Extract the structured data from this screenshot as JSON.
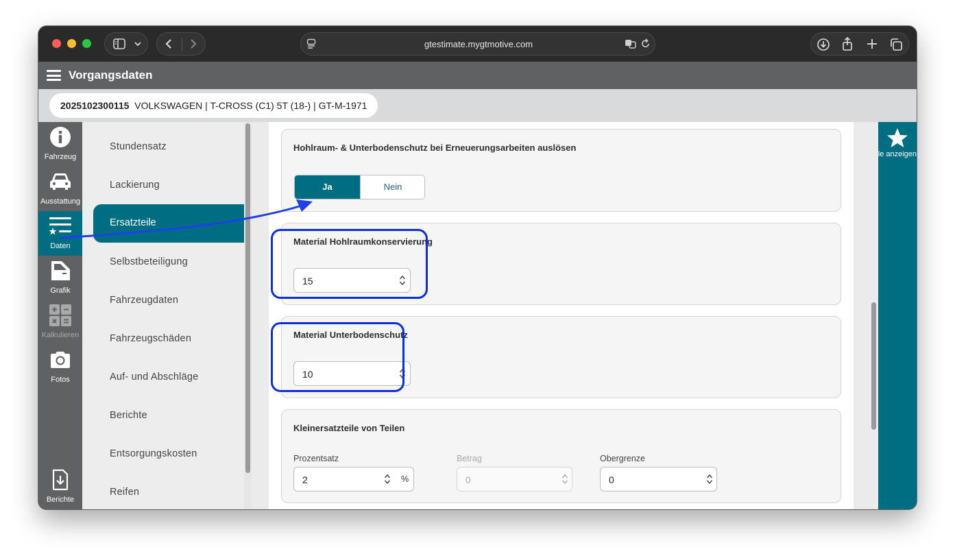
{
  "browser": {
    "url": "gtestimate.mygtmotive.com",
    "icons": [
      "sidebar-icon",
      "chevron-down-icon",
      "back-icon",
      "forward-icon",
      "page-icon",
      "translate-icon",
      "reload-icon",
      "download-icon",
      "share-icon",
      "new-tab-icon",
      "tabs-icon"
    ]
  },
  "app": {
    "title": "Vorgangsdaten",
    "vehicle": {
      "id": "2025102300115",
      "description": "VOLKSWAGEN | T-CROSS (C1) 5T (18-) | GT-M-1971"
    }
  },
  "rail": {
    "items": [
      {
        "label": "Fahrzeug",
        "icon": "info-icon"
      },
      {
        "label": "Ausstattung",
        "icon": "car-icon"
      },
      {
        "label": "Daten",
        "icon": "list-star-icon",
        "active": true
      },
      {
        "label": "Grafik",
        "icon": "door-icon"
      },
      {
        "label": "Kalkulieren",
        "icon": "calculator-icon",
        "disabled": true
      },
      {
        "label": "Fotos",
        "icon": "camera-icon"
      },
      {
        "label": "Berichte",
        "icon": "file-download-icon"
      }
    ]
  },
  "subnav": {
    "items": [
      "Stundensatz",
      "Lackierung",
      "Ersatzteile",
      "Selbstbeteiligung",
      "Fahrzeugdaten",
      "Fahrzeugschäden",
      "Auf- und Abschläge",
      "Berichte",
      "Entsorgungskosten",
      "Reifen"
    ],
    "active": "Ersatzteile"
  },
  "main": {
    "cavity_trigger": {
      "title": "Hohlraum- & Unterbodenschutz bei Erneuerungsarbeiten auslösen",
      "options": [
        "Ja",
        "Nein"
      ],
      "selected": "Ja"
    },
    "cavity_material": {
      "title": "Material Hohlraumkonservierung",
      "value": "15"
    },
    "underbody_material": {
      "title": "Material Unterbodenschutz",
      "value": "10"
    },
    "small_parts": {
      "title": "Kleinersatzteile von Teilen",
      "percent_label": "Prozentsatz",
      "percent_value": "2",
      "percent_unit": "%",
      "amount_label": "Betrag",
      "amount_value": "0",
      "limit_label": "Obergrenze",
      "limit_value": "0"
    }
  },
  "right_panel": {
    "label": "Alle anzeigen",
    "icon": "star-icon"
  },
  "annotation": {
    "highlight_color": "#0a2ee6",
    "arrow_color": "#1f3fe8"
  },
  "colors": {
    "brand": "#006e82",
    "header": "#5f6163"
  }
}
